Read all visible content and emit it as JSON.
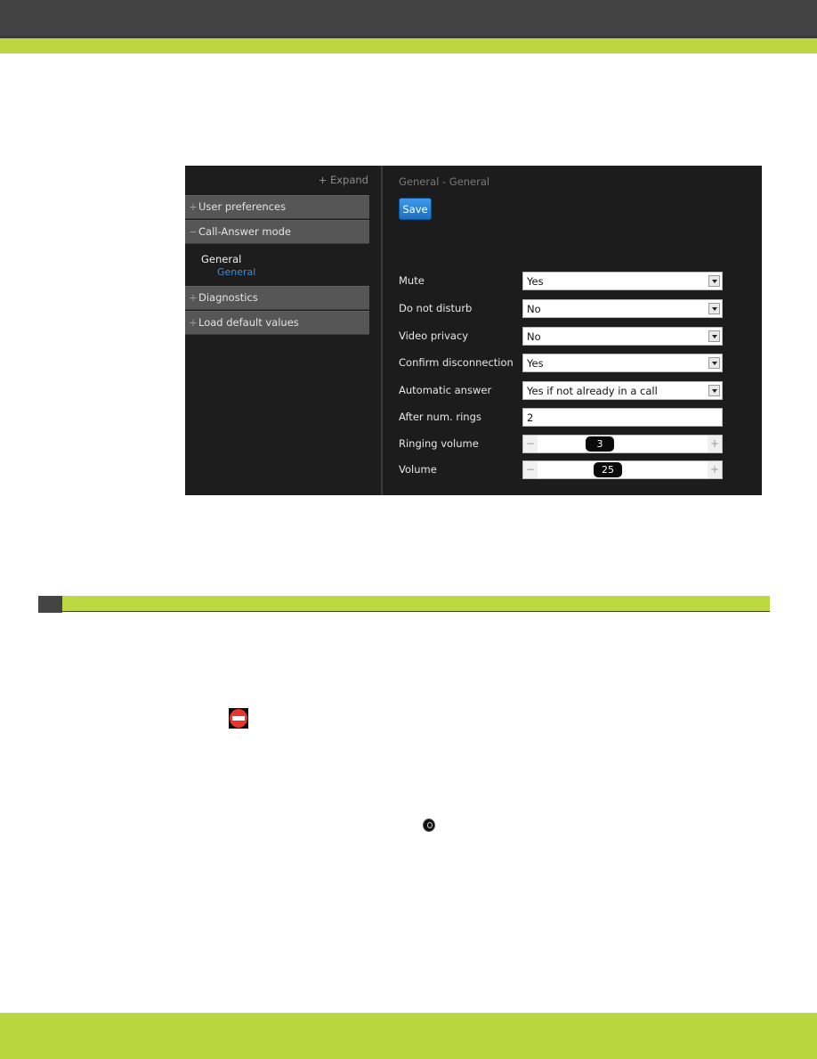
{
  "colors": {
    "header": "#434343",
    "accent_green": "#bdd640",
    "panel_bg": "#1c1c1c",
    "section_bg": "#565656",
    "link_blue": "#3a8ed6",
    "save_blue": "#1b6fc2"
  },
  "sidebar": {
    "expand_label": "+ Expand",
    "sections": [
      {
        "symbol": "+",
        "label": "User preferences",
        "expanded": false
      },
      {
        "symbol": "−",
        "label": "Call-Answer mode",
        "expanded": true
      },
      {
        "symbol": "+",
        "label": "Diagnostics",
        "expanded": false
      },
      {
        "symbol": "+",
        "label": "Load default values",
        "expanded": false
      }
    ],
    "tree": {
      "group": "General",
      "selected_leaf": "General"
    }
  },
  "content": {
    "breadcrumb": "General - General",
    "save_label": "Save",
    "fields": [
      {
        "label": "Mute",
        "type": "select",
        "value": "Yes"
      },
      {
        "label": "Do not disturb",
        "type": "select",
        "value": "No"
      },
      {
        "label": "Video privacy",
        "type": "select",
        "value": "No"
      },
      {
        "label": "Confirm disconnection",
        "type": "select",
        "value": "Yes"
      },
      {
        "label": "Automatic answer",
        "type": "select",
        "value": "Yes if not already in a call"
      },
      {
        "label": "After num. rings",
        "type": "text",
        "value": "2"
      },
      {
        "label": "Ringing volume",
        "type": "stepper",
        "value": "3",
        "minus": "−",
        "plus": "+"
      },
      {
        "label": "Volume",
        "type": "stepper",
        "value": "25",
        "minus": "−",
        "plus": "+"
      }
    ]
  },
  "icons": {
    "do_not_disturb": "do-not-disturb-icon",
    "round_button": "round-button-icon"
  }
}
